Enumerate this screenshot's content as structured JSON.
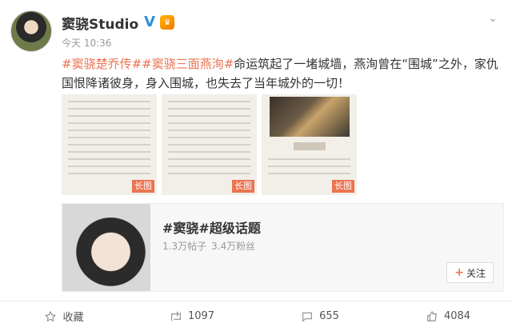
{
  "account": {
    "name": "窦骁Studio",
    "verified_icon": "V",
    "vip_icon": "vip"
  },
  "post": {
    "time": "今天 10:36",
    "hashtags": [
      "#窦骁楚乔传#",
      "#窦骁三面燕洵#"
    ],
    "text_line1": "命运筑起了一堵城墙，燕洵曾在“围城”之外，家仇",
    "text_line2": "国恨降诸彼身，身入围城，也失去了当年城外的一切！"
  },
  "images": [
    {
      "badge": "长图"
    },
    {
      "badge": "长图"
    },
    {
      "badge": "长图"
    }
  ],
  "topic_card": {
    "title": "#窦骁#超级话题",
    "posts": "1.3万帖子",
    "fans": "3.4万粉丝",
    "follow_label": "关注"
  },
  "actions": {
    "favorite": "收藏",
    "repost": "1097",
    "comment": "655",
    "like": "4084"
  }
}
